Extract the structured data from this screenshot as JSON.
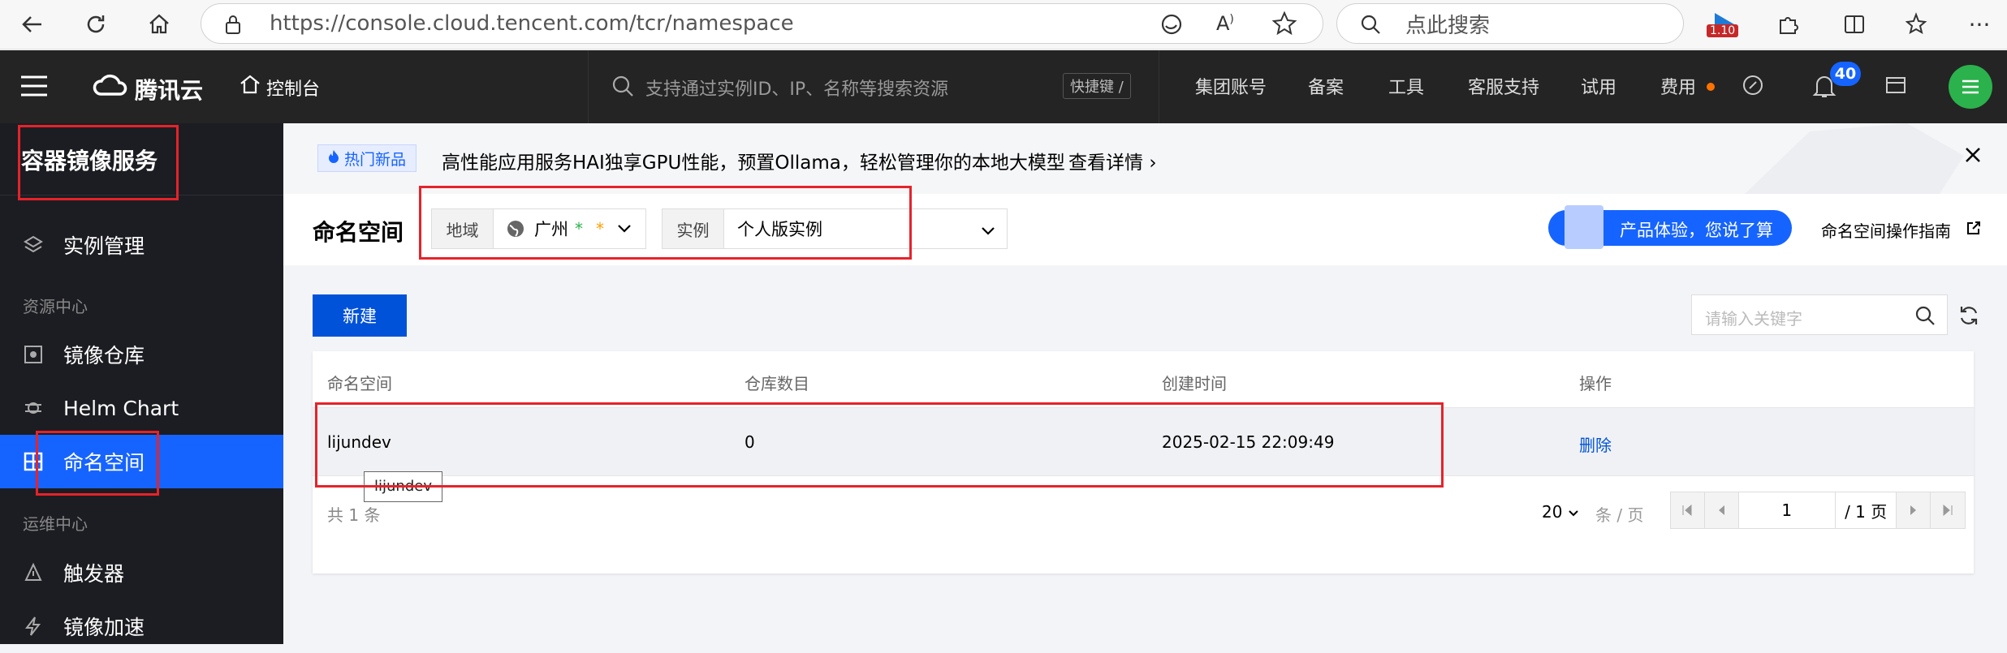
{
  "browser": {
    "url": "https://console.cloud.tencent.com/tcr/namespace",
    "search_placeholder": "点此搜索",
    "badge": "1.10"
  },
  "topnav": {
    "brand": "腾讯云",
    "console": "控制台",
    "search_placeholder": "支持通过实例ID、IP、名称等搜索资源",
    "shortcut": "快捷键 /",
    "links": [
      "集团账号",
      "备案",
      "工具",
      "客服支持",
      "试用",
      "费用"
    ],
    "notification_count": "40"
  },
  "sidebar": {
    "title": "容器镜像服务",
    "items": [
      {
        "label": "实例管理"
      },
      {
        "group": "资源中心"
      },
      {
        "label": "镜像仓库"
      },
      {
        "label": "Helm Chart"
      },
      {
        "label": "命名空间"
      },
      {
        "group": "运维中心"
      },
      {
        "label": "触发器"
      },
      {
        "label": "镜像加速"
      }
    ]
  },
  "banner": {
    "tag": "热门新品",
    "text": "高性能应用服务HAI独享GPU性能，预置Ollama，轻松管理你的本地大模型",
    "link": "查看详情"
  },
  "header": {
    "title": "命名空间",
    "region_label": "地域",
    "region_value": "广州",
    "instance_label": "实例",
    "instance_value": "个人版实例",
    "feedback": "产品体验，您说了算",
    "guide": "命名空间操作指南"
  },
  "toolbar": {
    "new_button": "新建",
    "search_placeholder": "请输入关键字"
  },
  "table": {
    "columns": [
      "命名空间",
      "仓库数目",
      "创建时间",
      "操作"
    ],
    "rows": [
      {
        "name": "lijundev",
        "repo_count": "0",
        "created": "2025-02-15 22:09:49",
        "action": "删除"
      }
    ],
    "tooltip": "lijundev"
  },
  "pagination": {
    "total_prefix": "共",
    "total": "1",
    "total_suffix": "条",
    "page_size": "20",
    "page_size_suffix": "条 / 页",
    "current_page": "1",
    "total_pages": "/ 1 页"
  },
  "colors": {
    "accent": "#0052d9",
    "highlight": "#e5232a",
    "sidebar_active": "#1664ff"
  }
}
